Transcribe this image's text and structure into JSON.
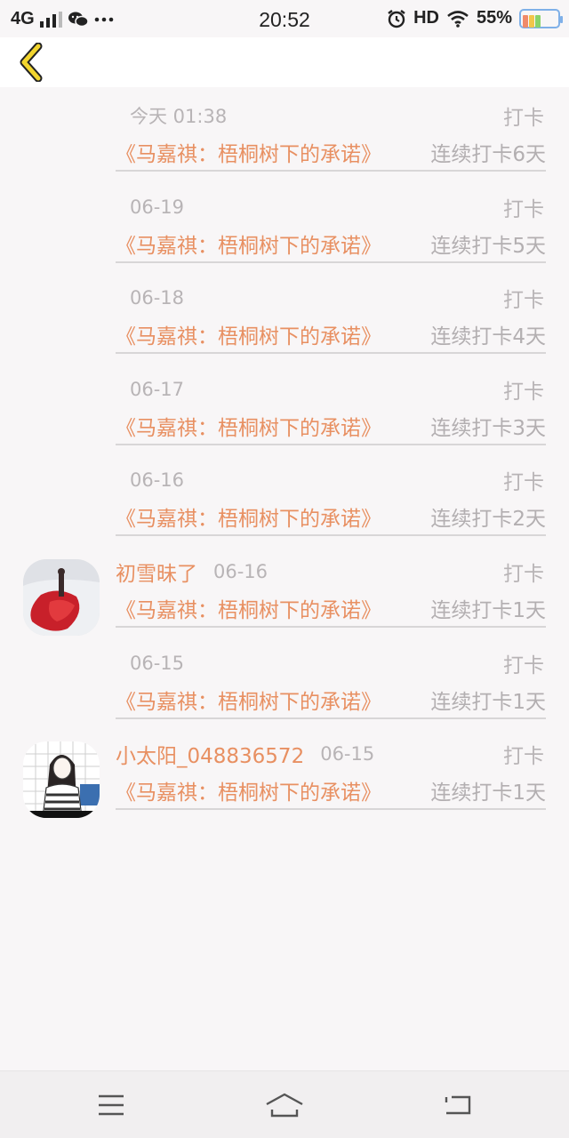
{
  "status_bar": {
    "network": "4G",
    "time": "20:52",
    "hd": "HD",
    "battery": "55%",
    "icons": [
      "signal-icon",
      "wechat-icon",
      "more-icon",
      "alarm-icon",
      "wifi-icon",
      "battery-icon"
    ]
  },
  "header": {
    "back_icon": "chevron-left-icon"
  },
  "feed": {
    "items": [
      {
        "user": "",
        "time": "今天 01:38",
        "tag": "打卡",
        "book": "《马嘉祺：梧桐树下的承诺》",
        "streak": "连续打卡6天"
      },
      {
        "user": "",
        "time": "06-19",
        "tag": "打卡",
        "book": "《马嘉祺：梧桐树下的承诺》",
        "streak": "连续打卡5天"
      },
      {
        "user": "",
        "time": "06-18",
        "tag": "打卡",
        "book": "《马嘉祺：梧桐树下的承诺》",
        "streak": "连续打卡4天"
      },
      {
        "user": "",
        "time": "06-17",
        "tag": "打卡",
        "book": "《马嘉祺：梧桐树下的承诺》",
        "streak": "连续打卡3天"
      },
      {
        "user": "",
        "time": "06-16",
        "tag": "打卡",
        "book": "《马嘉祺：梧桐树下的承诺》",
        "streak": "连续打卡2天"
      },
      {
        "user": "初雪昧了",
        "time": "06-16",
        "tag": "打卡",
        "book": "《马嘉祺：梧桐树下的承诺》",
        "streak": "连续打卡1天"
      },
      {
        "user": "",
        "time": "06-15",
        "tag": "打卡",
        "book": "《马嘉祺：梧桐树下的承诺》",
        "streak": "连续打卡1天"
      },
      {
        "user": "小太阳_048836572",
        "time": "06-15",
        "tag": "打卡",
        "book": "《马嘉祺：梧桐树下的承诺》",
        "streak": "连续打卡1天"
      }
    ]
  },
  "nav_bar": {
    "icons": [
      "menu-icon",
      "home-icon",
      "back-icon"
    ]
  },
  "colors": {
    "accent": "#e89062",
    "muted": "#b8b4b6",
    "background": "#f8f6f7",
    "back_arrow": "#e6c829"
  }
}
